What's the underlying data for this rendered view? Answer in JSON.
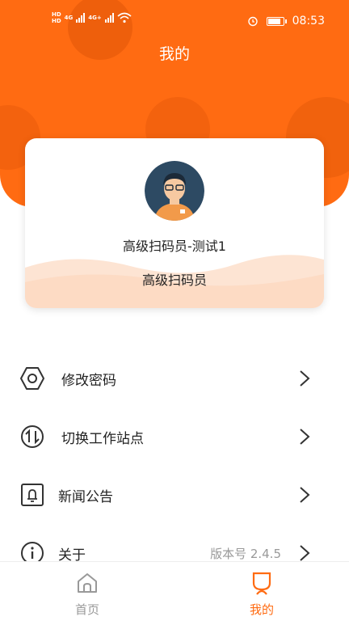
{
  "status_bar": {
    "network_top": "HD",
    "network_bottom": "HD",
    "gen1": "4G",
    "gen2": "4G+",
    "time": "08:53"
  },
  "header": {
    "title": "我的"
  },
  "profile": {
    "name": "高级扫码员-测试1",
    "role": "高级扫码员"
  },
  "menu": [
    {
      "label": "修改密码",
      "icon": "hexagon-nut-icon",
      "extra": ""
    },
    {
      "label": "切换工作站点",
      "icon": "swap-arrows-icon",
      "extra": ""
    },
    {
      "label": "新闻公告",
      "icon": "bell-icon",
      "extra": ""
    },
    {
      "label": "关于",
      "icon": "info-icon",
      "extra": "版本号 2.4.5"
    }
  ],
  "tabbar": {
    "tabs": [
      {
        "label": "首页",
        "icon": "home-icon",
        "active": false
      },
      {
        "label": "我的",
        "icon": "profile-icon",
        "active": true
      }
    ]
  },
  "colors": {
    "accent": "#ff6b12",
    "inactive_tab": "#999999",
    "active_tab": "#ff6b12"
  }
}
